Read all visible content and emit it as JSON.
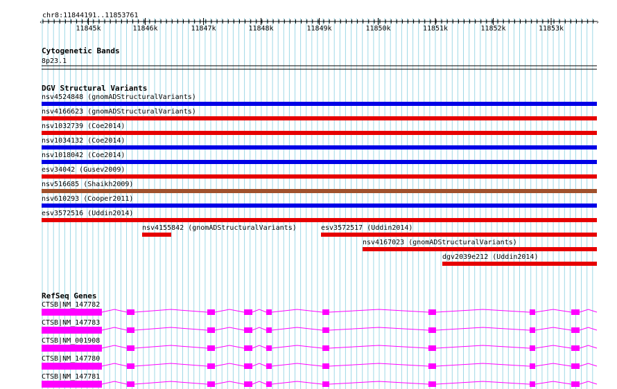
{
  "header": {
    "locus": "chr8:11844191..11853761",
    "ticks": [
      "11845k",
      "11846k",
      "11847k",
      "11848k",
      "11849k",
      "11850k",
      "11851k",
      "11852k",
      "11853k"
    ]
  },
  "cytoband_track": {
    "title": "Cytogenetic Bands",
    "band": "8p23.1"
  },
  "dgv_track": {
    "title": "DGV Structural Variants",
    "features": [
      {
        "label": "nsv4524848 (gnomADStructuralVariants)",
        "color": "#0000e6"
      },
      {
        "label": "nsv4166623 (gnomADStructuralVariants)",
        "color": "#e60000"
      },
      {
        "label": "nsv1032739 (Coe2014)",
        "color": "#e60000"
      },
      {
        "label": "nsv1034132 (Coe2014)",
        "color": "#0000e6"
      },
      {
        "label": "nsv1018042 (Coe2014)",
        "color": "#0000e6"
      },
      {
        "label": "esv34042 (Gusev2009)",
        "color": "#e60000"
      },
      {
        "label": "nsv516685 (Shaikh2009)",
        "color": "#a0522d"
      },
      {
        "label": "nsv610293 (Cooper2011)",
        "color": "#0000e6"
      },
      {
        "label": "esv3572516 (Uddin2014)",
        "color": "#e60000"
      },
      {
        "label": "nsv4155842 (gnomADStructuralVariants)",
        "color": "#e60000"
      },
      {
        "label": "esv3572517 (Uddin2014)",
        "color": "#e60000"
      },
      {
        "label": "nsv4167023 (gnomADStructuralVariants)",
        "color": "#e60000"
      },
      {
        "label": "dgv2039e212 (Uddin2014)",
        "color": "#e60000"
      }
    ]
  },
  "refseq_track": {
    "title": "RefSeq Genes",
    "exon_color": "#ff00ff",
    "transcripts": [
      {
        "label": "CTSB|NM_147782"
      },
      {
        "label": "CTSB|NM_147783"
      },
      {
        "label": "CTSB|NM_001908"
      },
      {
        "label": "CTSB|NM_147780"
      },
      {
        "label": "CTSB|NM_147781"
      }
    ]
  }
}
